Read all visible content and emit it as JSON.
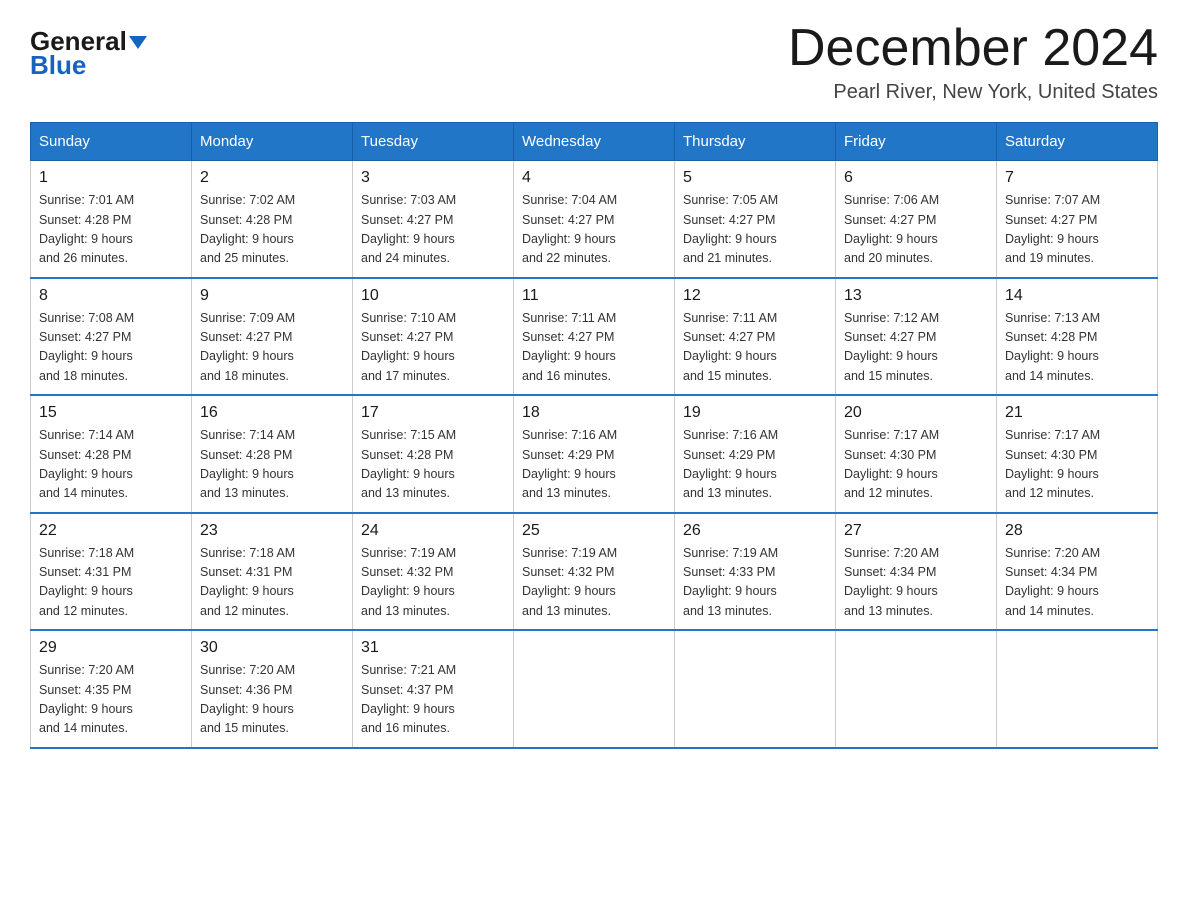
{
  "header": {
    "logo_general": "General",
    "logo_blue": "Blue",
    "month": "December 2024",
    "location": "Pearl River, New York, United States"
  },
  "days_of_week": [
    "Sunday",
    "Monday",
    "Tuesday",
    "Wednesday",
    "Thursday",
    "Friday",
    "Saturday"
  ],
  "weeks": [
    [
      {
        "num": "1",
        "sunrise": "7:01 AM",
        "sunset": "4:28 PM",
        "daylight": "9 hours and 26 minutes."
      },
      {
        "num": "2",
        "sunrise": "7:02 AM",
        "sunset": "4:28 PM",
        "daylight": "9 hours and 25 minutes."
      },
      {
        "num": "3",
        "sunrise": "7:03 AM",
        "sunset": "4:27 PM",
        "daylight": "9 hours and 24 minutes."
      },
      {
        "num": "4",
        "sunrise": "7:04 AM",
        "sunset": "4:27 PM",
        "daylight": "9 hours and 22 minutes."
      },
      {
        "num": "5",
        "sunrise": "7:05 AM",
        "sunset": "4:27 PM",
        "daylight": "9 hours and 21 minutes."
      },
      {
        "num": "6",
        "sunrise": "7:06 AM",
        "sunset": "4:27 PM",
        "daylight": "9 hours and 20 minutes."
      },
      {
        "num": "7",
        "sunrise": "7:07 AM",
        "sunset": "4:27 PM",
        "daylight": "9 hours and 19 minutes."
      }
    ],
    [
      {
        "num": "8",
        "sunrise": "7:08 AM",
        "sunset": "4:27 PM",
        "daylight": "9 hours and 18 minutes."
      },
      {
        "num": "9",
        "sunrise": "7:09 AM",
        "sunset": "4:27 PM",
        "daylight": "9 hours and 18 minutes."
      },
      {
        "num": "10",
        "sunrise": "7:10 AM",
        "sunset": "4:27 PM",
        "daylight": "9 hours and 17 minutes."
      },
      {
        "num": "11",
        "sunrise": "7:11 AM",
        "sunset": "4:27 PM",
        "daylight": "9 hours and 16 minutes."
      },
      {
        "num": "12",
        "sunrise": "7:11 AM",
        "sunset": "4:27 PM",
        "daylight": "9 hours and 15 minutes."
      },
      {
        "num": "13",
        "sunrise": "7:12 AM",
        "sunset": "4:27 PM",
        "daylight": "9 hours and 15 minutes."
      },
      {
        "num": "14",
        "sunrise": "7:13 AM",
        "sunset": "4:28 PM",
        "daylight": "9 hours and 14 minutes."
      }
    ],
    [
      {
        "num": "15",
        "sunrise": "7:14 AM",
        "sunset": "4:28 PM",
        "daylight": "9 hours and 14 minutes."
      },
      {
        "num": "16",
        "sunrise": "7:14 AM",
        "sunset": "4:28 PM",
        "daylight": "9 hours and 13 minutes."
      },
      {
        "num": "17",
        "sunrise": "7:15 AM",
        "sunset": "4:28 PM",
        "daylight": "9 hours and 13 minutes."
      },
      {
        "num": "18",
        "sunrise": "7:16 AM",
        "sunset": "4:29 PM",
        "daylight": "9 hours and 13 minutes."
      },
      {
        "num": "19",
        "sunrise": "7:16 AM",
        "sunset": "4:29 PM",
        "daylight": "9 hours and 13 minutes."
      },
      {
        "num": "20",
        "sunrise": "7:17 AM",
        "sunset": "4:30 PM",
        "daylight": "9 hours and 12 minutes."
      },
      {
        "num": "21",
        "sunrise": "7:17 AM",
        "sunset": "4:30 PM",
        "daylight": "9 hours and 12 minutes."
      }
    ],
    [
      {
        "num": "22",
        "sunrise": "7:18 AM",
        "sunset": "4:31 PM",
        "daylight": "9 hours and 12 minutes."
      },
      {
        "num": "23",
        "sunrise": "7:18 AM",
        "sunset": "4:31 PM",
        "daylight": "9 hours and 12 minutes."
      },
      {
        "num": "24",
        "sunrise": "7:19 AM",
        "sunset": "4:32 PM",
        "daylight": "9 hours and 13 minutes."
      },
      {
        "num": "25",
        "sunrise": "7:19 AM",
        "sunset": "4:32 PM",
        "daylight": "9 hours and 13 minutes."
      },
      {
        "num": "26",
        "sunrise": "7:19 AM",
        "sunset": "4:33 PM",
        "daylight": "9 hours and 13 minutes."
      },
      {
        "num": "27",
        "sunrise": "7:20 AM",
        "sunset": "4:34 PM",
        "daylight": "9 hours and 13 minutes."
      },
      {
        "num": "28",
        "sunrise": "7:20 AM",
        "sunset": "4:34 PM",
        "daylight": "9 hours and 14 minutes."
      }
    ],
    [
      {
        "num": "29",
        "sunrise": "7:20 AM",
        "sunset": "4:35 PM",
        "daylight": "9 hours and 14 minutes."
      },
      {
        "num": "30",
        "sunrise": "7:20 AM",
        "sunset": "4:36 PM",
        "daylight": "9 hours and 15 minutes."
      },
      {
        "num": "31",
        "sunrise": "7:21 AM",
        "sunset": "4:37 PM",
        "daylight": "9 hours and 16 minutes."
      },
      null,
      null,
      null,
      null
    ]
  ]
}
